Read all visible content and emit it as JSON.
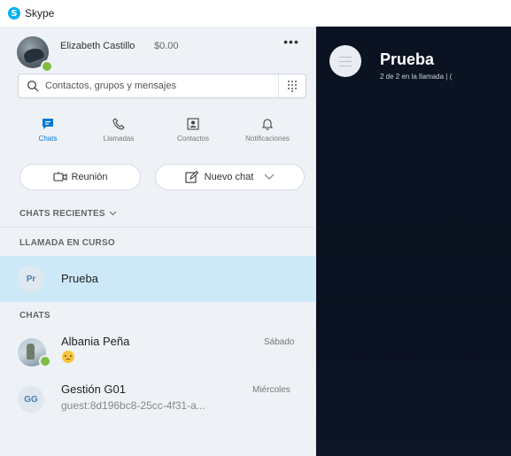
{
  "app": {
    "title": "Skype",
    "logo_letter": "S"
  },
  "profile": {
    "name": "Elizabeth Castillo",
    "credit": "$0.00",
    "more": "•••"
  },
  "search": {
    "placeholder": "Contactos, grupos y mensajes"
  },
  "tabs": [
    {
      "label": "Chats",
      "icon": "chat-icon",
      "active": true
    },
    {
      "label": "Llamadas",
      "icon": "phone-icon",
      "active": false
    },
    {
      "label": "Contactos",
      "icon": "contacts-icon",
      "active": false
    },
    {
      "label": "Notificaciones",
      "icon": "bell-icon",
      "active": false
    }
  ],
  "actions": {
    "meeting": "Reunión",
    "new_chat": "Nuevo chat"
  },
  "sections": {
    "recent": "CHATS RECIENTES",
    "ongoing": "LLAMADA EN CURSO",
    "chats": "CHATS"
  },
  "ongoing_call": {
    "initials": "Pr",
    "name": "Prueba"
  },
  "chats": [
    {
      "name": "Albania Peña",
      "time": "Sábado",
      "preview_icon": "confused-face-emoji"
    },
    {
      "initials": "GG",
      "name": "Gestión G01",
      "time": "Miércoles",
      "preview": "guest:8d196bc8-25cc-4f31-a..."
    }
  ],
  "call": {
    "title": "Prueba",
    "subtitle": "2 de 2 en la llamada | ("
  },
  "colors": {
    "accent": "#0078d4",
    "selected_row": "#cde9f8",
    "presence_online": "#7cbd3f",
    "call_background": "#0b1323"
  }
}
